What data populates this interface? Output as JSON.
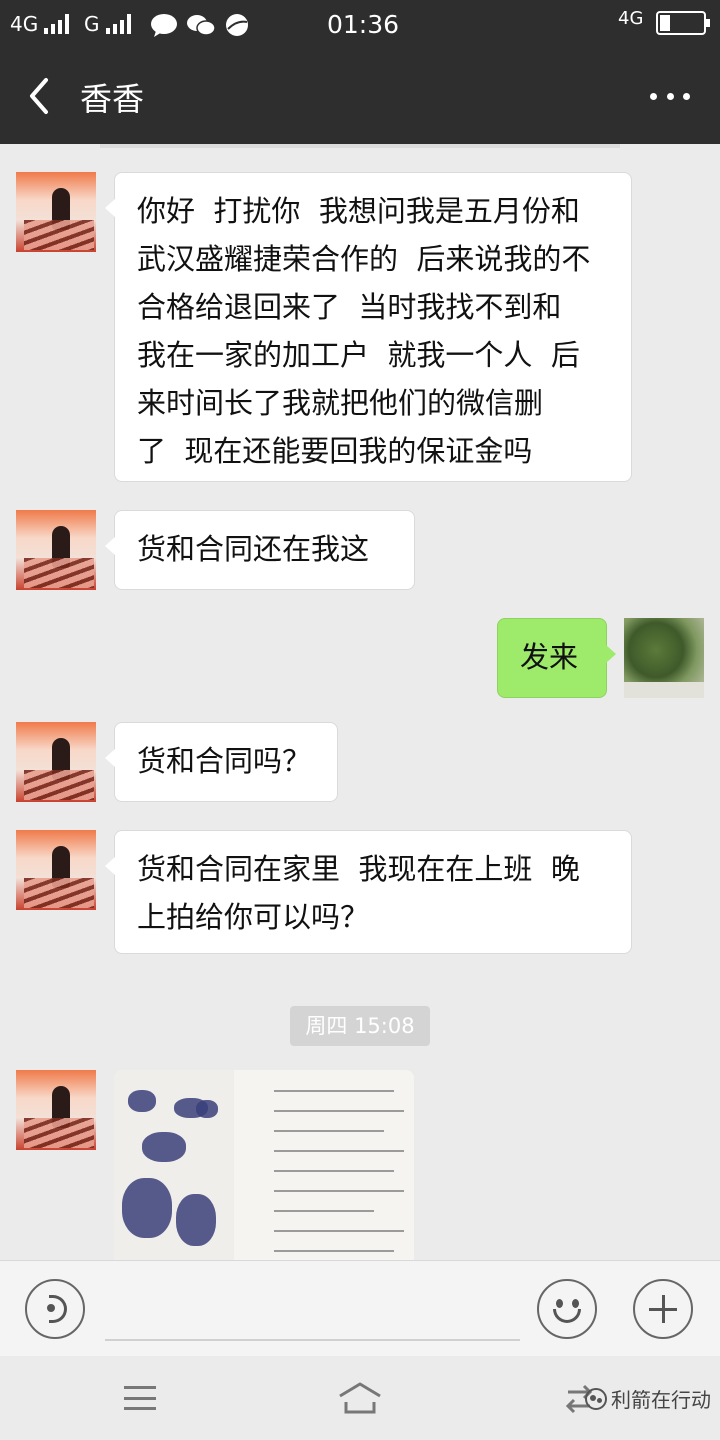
{
  "status_bar": {
    "network_1": "4G",
    "network_2": "G",
    "time": "01:36",
    "network_3": "4G",
    "icons": [
      "signal-icon",
      "signal-icon",
      "message-icon",
      "wechat-icon",
      "browser-icon",
      "battery-icon"
    ]
  },
  "header": {
    "title": "香香",
    "back_icon": "chevron-left-icon",
    "more_icon": "more-dots-icon"
  },
  "messages": [
    {
      "side": "left",
      "text": "你好  打扰你  我想问我是五月份和\n武汉盛耀捷荣合作的  后来说我的不\n合格给退回来了  当时我找不到和\n我在一家的加工户  就我一个人  后\n来时间长了我就把他们的微信删\n了  现在还能要回我的保证金吗"
    },
    {
      "side": "left",
      "text": "货和合同还在我这"
    },
    {
      "side": "right",
      "text": "发来"
    },
    {
      "side": "left",
      "text": "货和合同吗？"
    },
    {
      "side": "left",
      "text": "货和合同在家里  我现在在上班  晚\n上拍给你可以吗？"
    }
  ],
  "timestamp": "周四 15:08",
  "input_bar": {
    "voice_icon": "voice-icon",
    "emoji_icon": "emoji-icon",
    "plus_icon": "plus-icon"
  },
  "nav_bar": {
    "menu_icon": "menu-icon",
    "home_icon": "home-icon",
    "back_icon": "back-icon"
  },
  "watermark": "利箭在行动",
  "colors": {
    "header_bg": "#2e2e2e",
    "chat_bg": "#ebebeb",
    "bubble_left": "#ffffff",
    "bubble_right": "#9eea6a"
  }
}
